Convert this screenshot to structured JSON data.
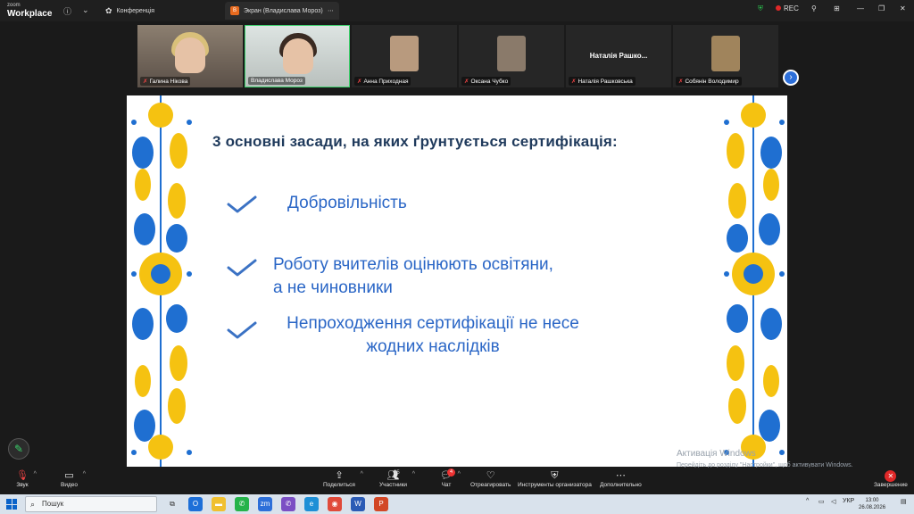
{
  "app": {
    "logo_top": "zoom",
    "logo_bottom": "Workplace",
    "tabs": [
      {
        "label": "Конференція"
      },
      {
        "badge": "B",
        "label": "Экран (Владислава Мороз)"
      }
    ],
    "rec_label": "REC"
  },
  "participants": [
    {
      "name": "Галина Нікова"
    },
    {
      "name": "Владислава Мороз"
    },
    {
      "name": "Анна Приходная"
    },
    {
      "name": "Оксана Чубко"
    },
    {
      "name": "Наталія Рашковська",
      "display": "Наталія Рашко..."
    },
    {
      "name": "Собянін Володимир"
    }
  ],
  "slide": {
    "title": "3 основні засади, на яких ґрунтується сертифікація:",
    "items": [
      {
        "line1": "Добровільність",
        "line2": ""
      },
      {
        "line1": "Роботу вчителів оцінюють освітяни,",
        "line2": "а не чиновники"
      },
      {
        "line1": "Непроходження сертифікації не несе",
        "line2": "жодних наслідків"
      }
    ],
    "colors": {
      "title": "#1f3a5c",
      "items": "#2a66c6",
      "check": "#3b72c4",
      "yellow": "#f5c211",
      "blue": "#1f6fd1"
    }
  },
  "watermark": {
    "line1": "Активація Windows",
    "line2": "Перейдіть до розділу \"Настройки\", щоб активувати Windows."
  },
  "toolbar": {
    "audio": "Звук",
    "video": "Видео",
    "share": "Поделиться",
    "participants": "Участники",
    "participants_count": "95",
    "chat": "Чат",
    "chat_badge": "4",
    "react": "Отреагировать",
    "host_tools": "Инструменты организатора",
    "more": "Дополнительно",
    "end": "Завершение"
  },
  "taskbar": {
    "search": "Пошук",
    "lang": "УКР",
    "time": "13:00",
    "date": "26.08.2026"
  }
}
